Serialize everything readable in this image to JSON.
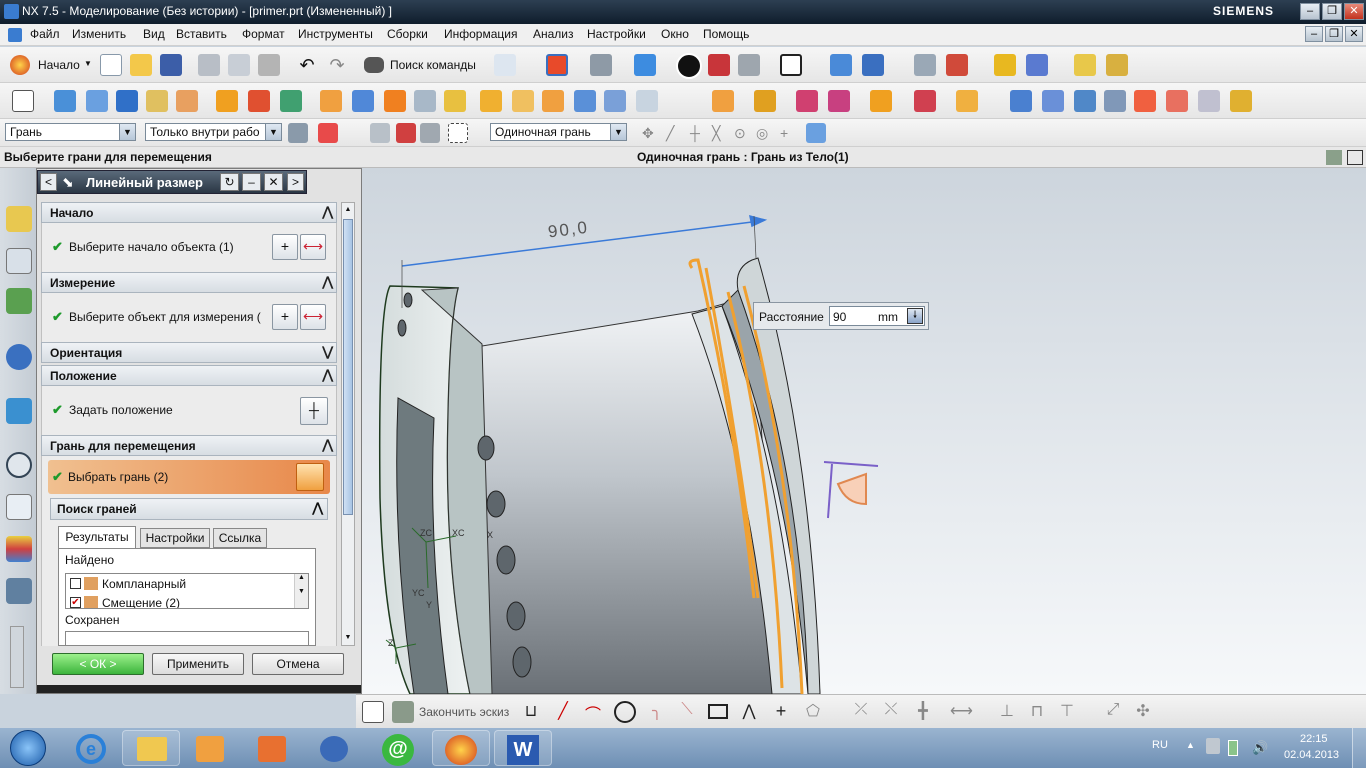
{
  "titlebar": {
    "title": "NX 7.5 - Моделирование (Без истории) - [primer.prt (Измененный) ]",
    "brand": "SIEMENS"
  },
  "menu": [
    "Файл",
    "Изменить",
    "Вид",
    "Вставить",
    "Формат",
    "Инструменты",
    "Сборки",
    "Информация",
    "Анализ",
    "Настройки",
    "Окно",
    "Помощь"
  ],
  "toolbar": {
    "start_label": "Начало",
    "command_finder": "Поиск команды"
  },
  "selection_bar": {
    "filter": "Грань",
    "scope": "Только внутри рабо",
    "face_rule": "Одиночная грань"
  },
  "cue_line": {
    "prompt": "Выберите грани для перемещения",
    "status": "Одиночная грань : Грань из Тело(1)"
  },
  "dialog": {
    "title": "Линейный размер",
    "sections": {
      "start": {
        "header": "Начало",
        "item": "Выберите начало объекта (1)"
      },
      "measure": {
        "header": "Измерение",
        "item": "Выберите объект для измерения ("
      },
      "orientation": {
        "header": "Ориентация"
      },
      "position": {
        "header": "Положение",
        "item": "Задать положение"
      },
      "face_move": {
        "header": "Грань для перемещения",
        "item": "Выбрать грань (2)"
      },
      "face_find": {
        "header": "Поиск граней",
        "tabs": [
          "Результаты",
          "Настройки",
          "Ссылка"
        ],
        "found_label": "Найдено",
        "found": [
          "Компланарный",
          "Смещение (2)"
        ],
        "saved_label": "Сохранен"
      }
    },
    "buttons": {
      "ok": "< ОК >",
      "apply": "Применить",
      "cancel": "Отмена"
    }
  },
  "viewport": {
    "dimension_value": "90,0",
    "distance_label": "Расстояние",
    "distance_value": "90",
    "distance_unit": "mm",
    "axis_labels": {
      "zc": "ZC",
      "yc": "YC",
      "xc": "XC",
      "x": "X",
      "y": "Y",
      "z": "Z"
    }
  },
  "sketch_bar": {
    "finish_sketch": "Закончить эскиз"
  },
  "taskbar": {
    "lang": "RU",
    "time": "22:15",
    "date": "02.04.2013"
  }
}
